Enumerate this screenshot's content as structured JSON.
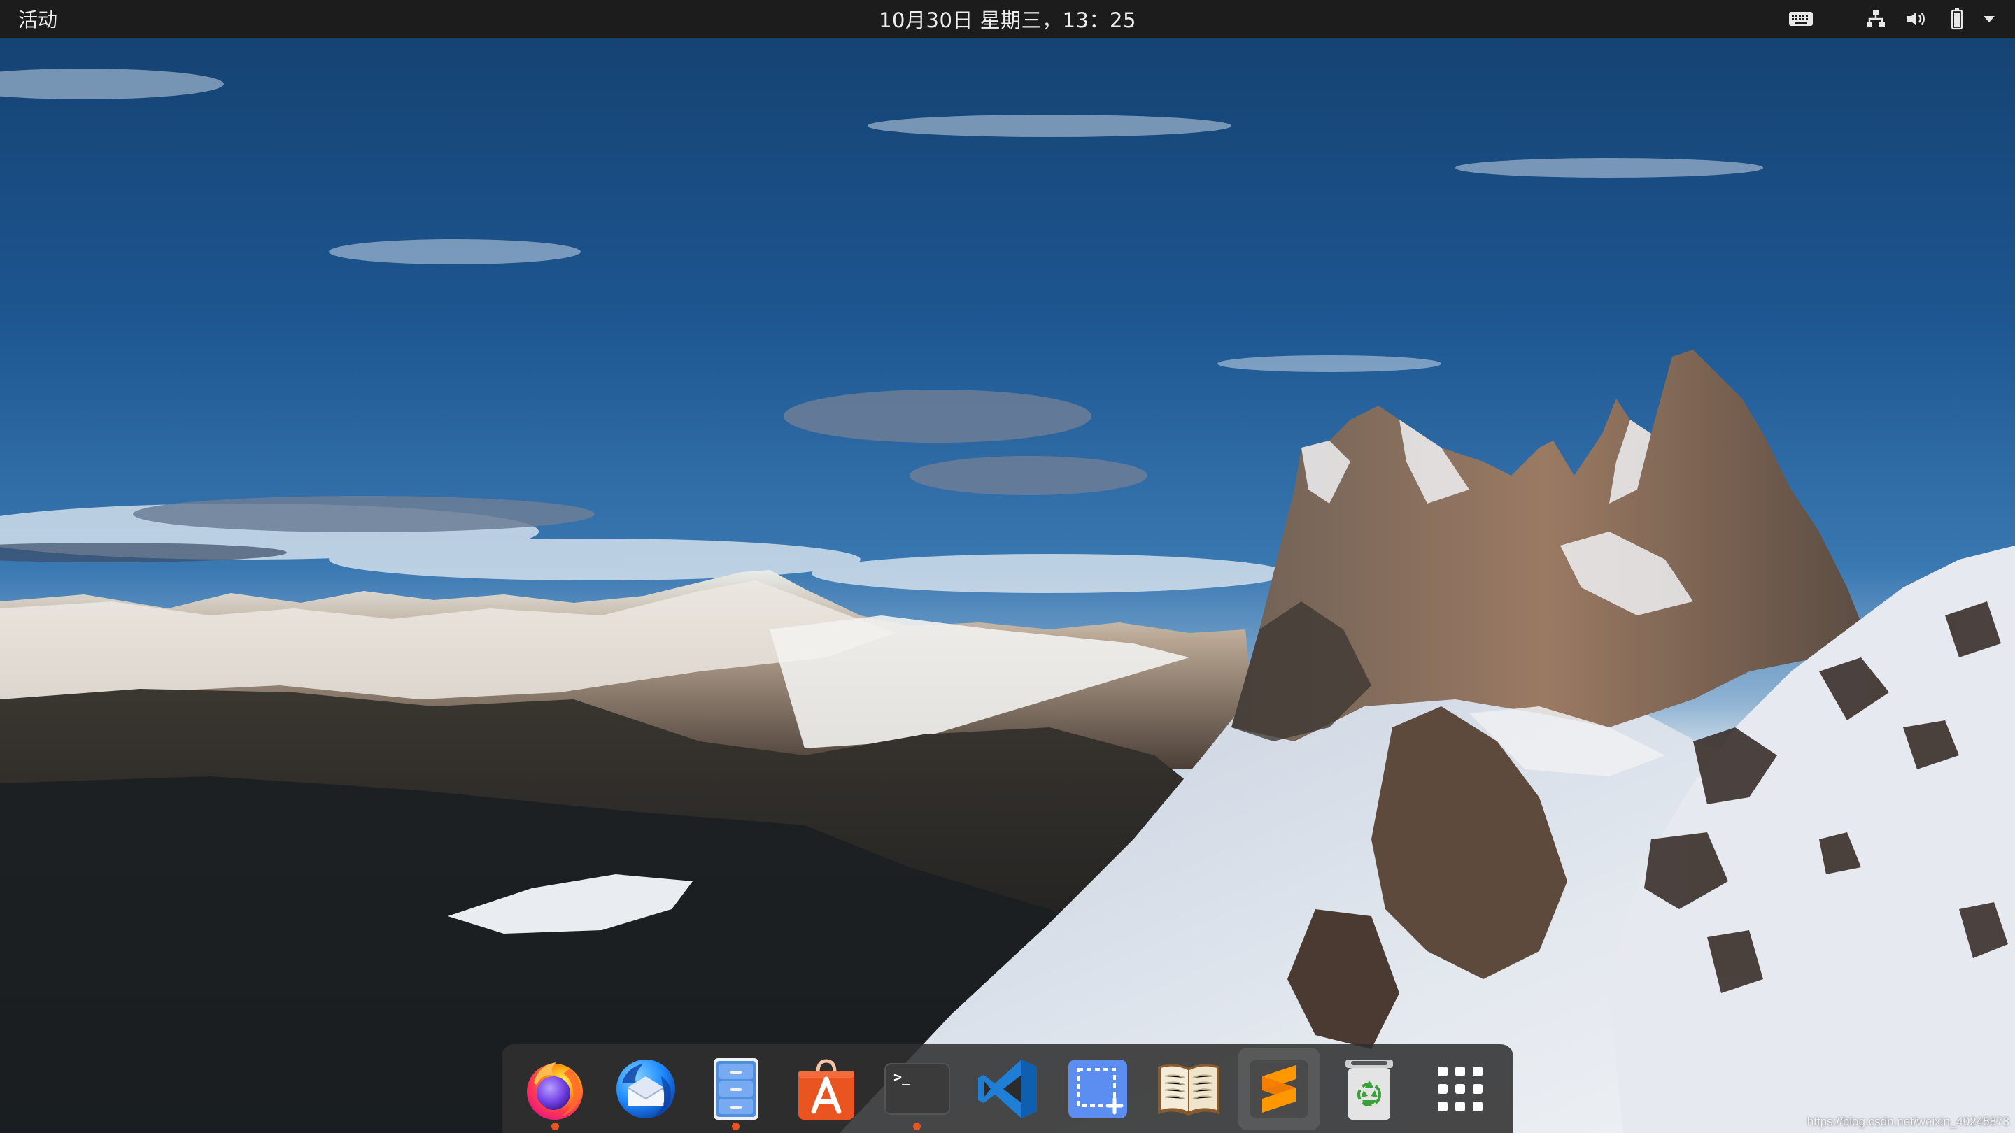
{
  "top_bar": {
    "activities_label": "活动",
    "clock": "10月30日 星期三，13：25",
    "tray_icons": [
      "keyboard-icon",
      "network-icon",
      "volume-icon",
      "battery-icon",
      "dropdown-arrow-icon"
    ]
  },
  "dock": {
    "apps": [
      {
        "name": "firefox",
        "running": true
      },
      {
        "name": "thunderbird",
        "running": false
      },
      {
        "name": "files",
        "running": true
      },
      {
        "name": "ubuntu-software",
        "running": false
      },
      {
        "name": "terminal",
        "running": true
      },
      {
        "name": "vscode",
        "running": false
      },
      {
        "name": "screenshot",
        "running": false
      },
      {
        "name": "reader",
        "running": false
      },
      {
        "name": "sublime-text",
        "running": false,
        "focused": true
      },
      {
        "name": "trash",
        "running": false
      },
      {
        "name": "show-applications",
        "running": false
      }
    ],
    "terminal_prompt": ">_"
  },
  "colors": {
    "top_bar": "#1c1c1c",
    "accent": "#e95420",
    "sky": "#1d4f86"
  },
  "watermark": "https://blog.csdn.net/weixin_40245873"
}
